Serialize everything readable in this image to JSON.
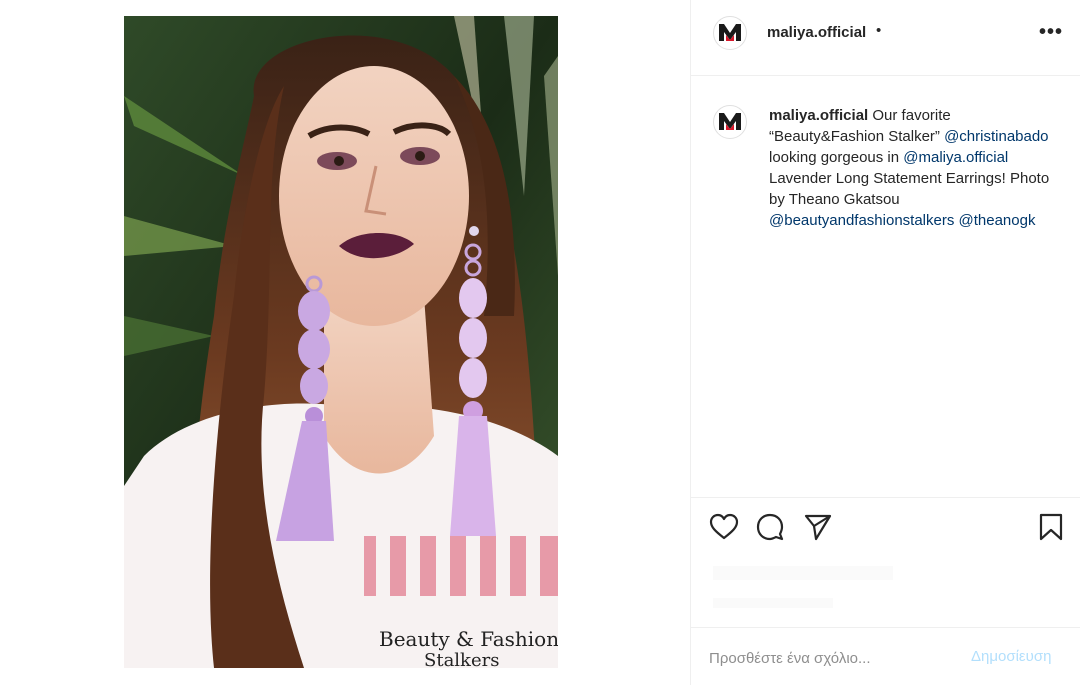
{
  "post": {
    "username": "maliya.official",
    "separator": "•",
    "more_icon": "more-horizontal-icon",
    "photo_shirt_text_1": "Beauty & Fashion",
    "photo_shirt_text_2": "Stalkers"
  },
  "caption": {
    "username": "maliya.official",
    "text_1": " Our favorite “Beauty&Fashion Stalker” ",
    "mention_1": "@christinabado",
    "text_2": " looking gorgeous in ",
    "mention_2": "@maliya.official",
    "text_3": " Lavender Long Statement Earrings! Photo by Theano Gkatsou ",
    "mention_3": "@beautyandfashionstalkers",
    "text_4": " ",
    "mention_4": "@theanogk"
  },
  "actions": {
    "like_icon": "heart-icon",
    "comment_icon": "comment-icon",
    "share_icon": "paper-plane-icon",
    "save_icon": "bookmark-icon"
  },
  "comment": {
    "placeholder": "Προσθέστε ένα σχόλιο...",
    "post_label": "Δημοσίευση"
  },
  "colors": {
    "mention": "#00376b",
    "post_button_disabled": "#b2dffc",
    "border": "#efefef",
    "logo_red": "#d6172a"
  }
}
